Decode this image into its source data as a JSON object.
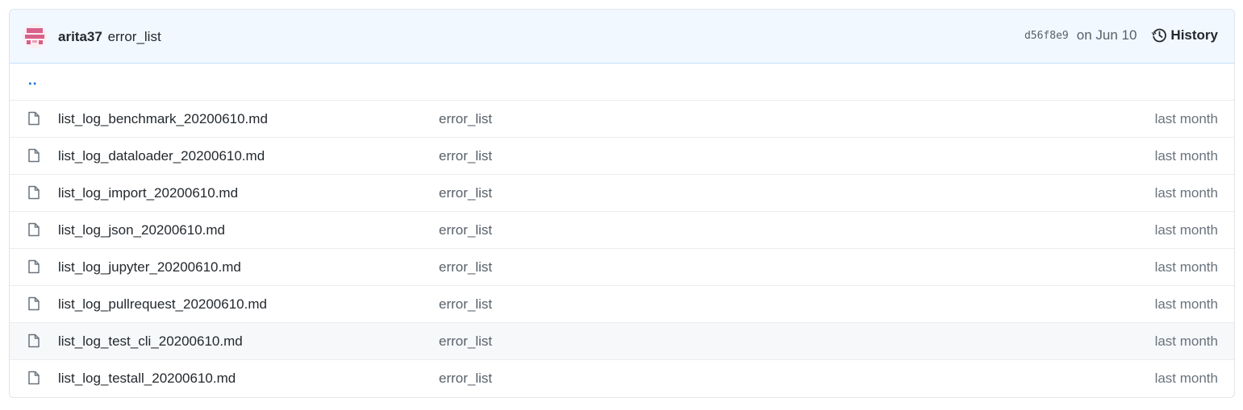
{
  "commit": {
    "author": "arita37",
    "message": "error_list",
    "sha": "d56f8e9",
    "date": "on Jun 10",
    "history_label": "History"
  },
  "parent_dir": "..",
  "files": [
    {
      "name": "list_log_benchmark_20200610.md",
      "message": "error_list",
      "age": "last month"
    },
    {
      "name": "list_log_dataloader_20200610.md",
      "message": "error_list",
      "age": "last month"
    },
    {
      "name": "list_log_import_20200610.md",
      "message": "error_list",
      "age": "last month"
    },
    {
      "name": "list_log_json_20200610.md",
      "message": "error_list",
      "age": "last month"
    },
    {
      "name": "list_log_jupyter_20200610.md",
      "message": "error_list",
      "age": "last month"
    },
    {
      "name": "list_log_pullrequest_20200610.md",
      "message": "error_list",
      "age": "last month"
    },
    {
      "name": "list_log_test_cli_20200610.md",
      "message": "error_list",
      "age": "last month"
    },
    {
      "name": "list_log_testall_20200610.md",
      "message": "error_list",
      "age": "last month"
    }
  ],
  "colors": {
    "header_bg": "#f1f8ff",
    "link": "#0366d6",
    "muted": "#586069",
    "avatar": "#d9608a"
  }
}
